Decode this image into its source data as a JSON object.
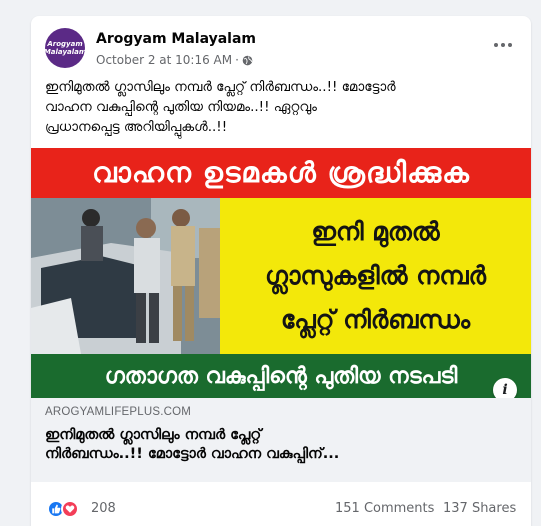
{
  "post": {
    "page_name": "Arogyam Malayalam",
    "avatar_text_line1": "Arogyam",
    "avatar_text_line2": "Malayalam",
    "timestamp": "October 2 at 10:16 AM",
    "privacy_icon": "globe-icon",
    "more_icon": "more-options-icon",
    "caption": "ഇനിമുതൽ ഗ്ലാസിലും നമ്പർ പ്ലേറ്റ് നിർബന്ധം..!! മോട്ടോർ\nവാഹന വകുപ്പിന്റെ പുതിയ നിയമം..!! ഏറ്റവും\nപ്രധാനപ്പെട്ട അറിയിപ്പുകൾ..!!"
  },
  "banner": {
    "top_text": "വാഹന ഉടമകൾ ശ്രദ്ധിക്കുക",
    "middle_line1": "ഇനി മുതൽ",
    "middle_line2": "ഗ്ലാസുകളിൽ നമ്പർ",
    "middle_line3": "പ്ലേറ്റ് നിർബന്ധം",
    "bottom_text": "ഗതാഗത വകുപ്പിന്റെ പുതിയ നടപടി",
    "info_label": "i",
    "colors": {
      "red": "#e8231a",
      "yellow": "#f3e80a",
      "green": "#1a6b2e"
    }
  },
  "link_preview": {
    "domain": "AROGYAMLIFEPLUS.COM",
    "title": "ഇനിമുതൽ ഗ്ലാസിലും നമ്പർ പ്ലേറ്റ്\nനിർബന്ധം..!! മോട്ടോർ വാഹന വകുപ്പിന്..."
  },
  "engagement": {
    "reaction_count": "208",
    "comments": "151 Comments",
    "shares": "137 Shares",
    "reaction_icons": [
      "like-icon",
      "love-icon"
    ]
  }
}
